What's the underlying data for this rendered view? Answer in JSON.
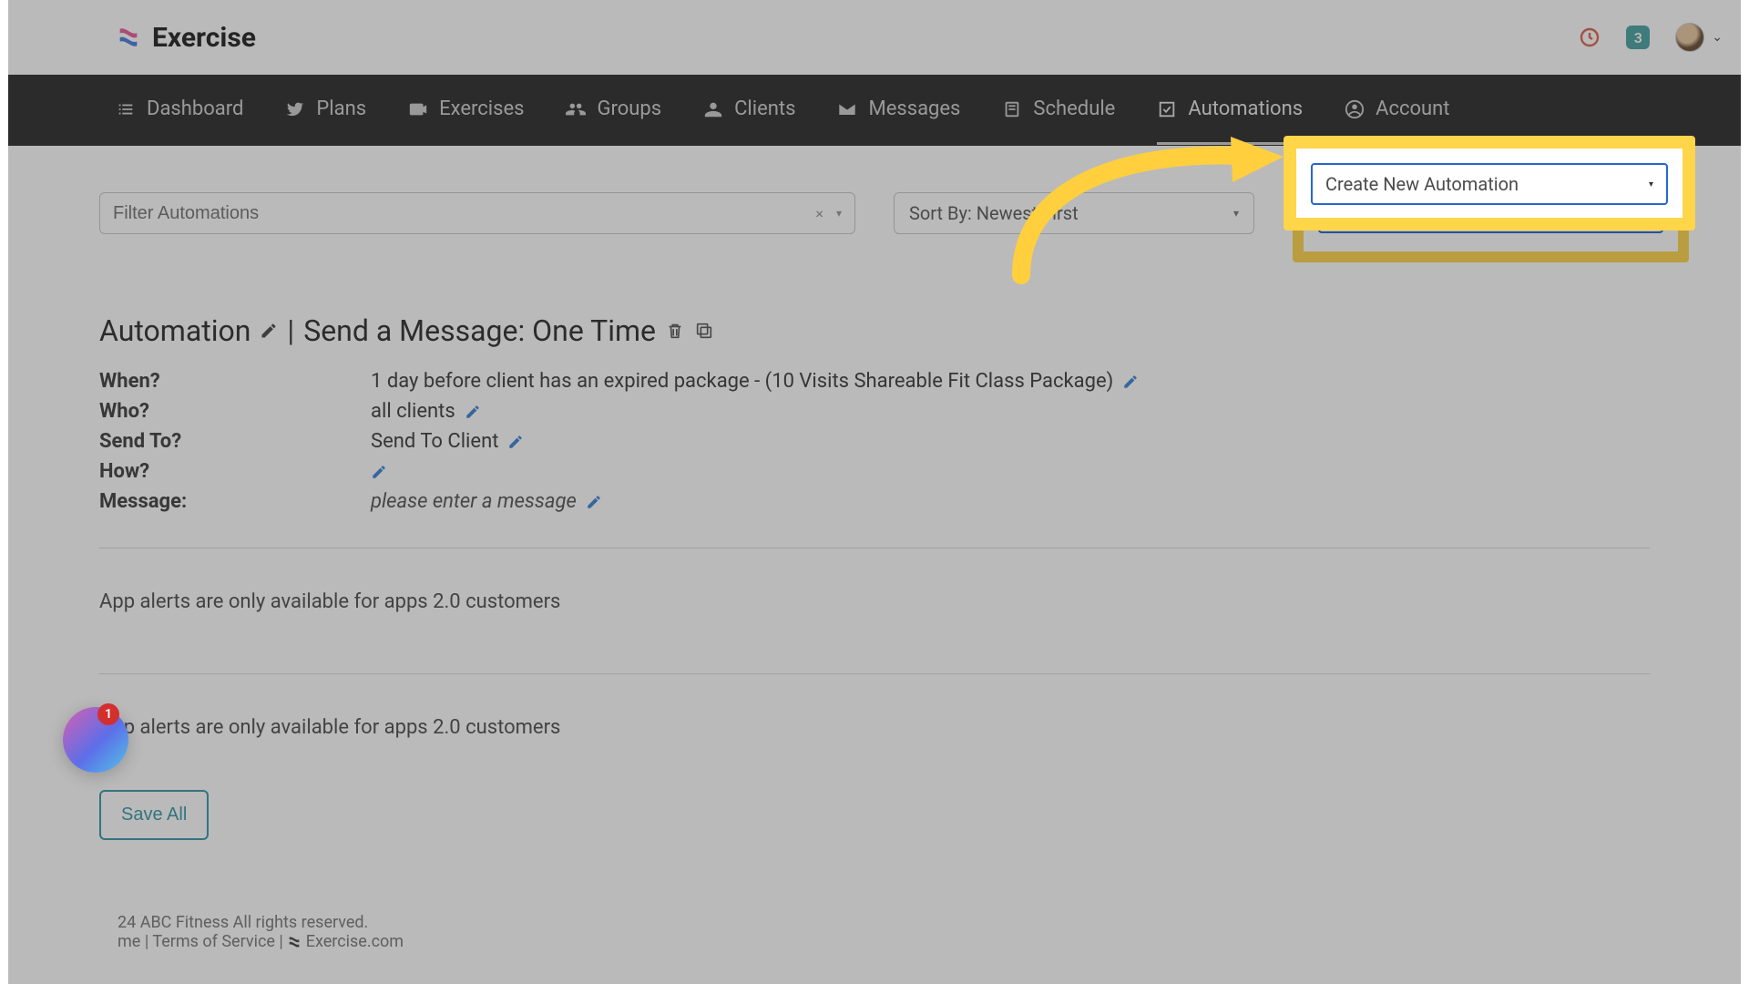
{
  "brand": {
    "name": "Exercise"
  },
  "header": {
    "badge_count": "3"
  },
  "nav": {
    "items": [
      {
        "label": "Dashboard",
        "icon": "list-icon"
      },
      {
        "label": "Plans",
        "icon": "bird-icon"
      },
      {
        "label": "Exercises",
        "icon": "video-icon"
      },
      {
        "label": "Groups",
        "icon": "people-icon"
      },
      {
        "label": "Clients",
        "icon": "person-icon"
      },
      {
        "label": "Messages",
        "icon": "envelope-icon"
      },
      {
        "label": "Schedule",
        "icon": "book-icon"
      },
      {
        "label": "Automations",
        "icon": "check-icon",
        "active": true
      },
      {
        "label": "Account",
        "icon": "user-circle-icon"
      }
    ]
  },
  "toolbar": {
    "filter_placeholder": "Filter Automations",
    "sort_label": "Sort By: Newest First",
    "create_label": "Create New Automation"
  },
  "automation": {
    "title_prefix": "Automation",
    "title_suffix": "Send a Message: One Time",
    "rows": {
      "when_label": "When?",
      "when_value": "1 day before client has an expired package - (10 Visits Shareable Fit Class Package)",
      "who_label": "Who?",
      "who_value": "all clients",
      "sendto_label": "Send To?",
      "sendto_value": "Send To Client",
      "how_label": "How?",
      "message_label": "Message:",
      "message_value": "please enter a message"
    }
  },
  "notices": {
    "line1": "App alerts are only available for apps 2.0 customers",
    "line2": "App alerts are only available for apps 2.0 customers"
  },
  "actions": {
    "save_all": "Save All"
  },
  "footer": {
    "copyright": "24 ABC Fitness All rights reserved.",
    "home": "me",
    "tos": "Terms of Service",
    "site": "Exercise.com"
  },
  "float": {
    "count": "1"
  }
}
